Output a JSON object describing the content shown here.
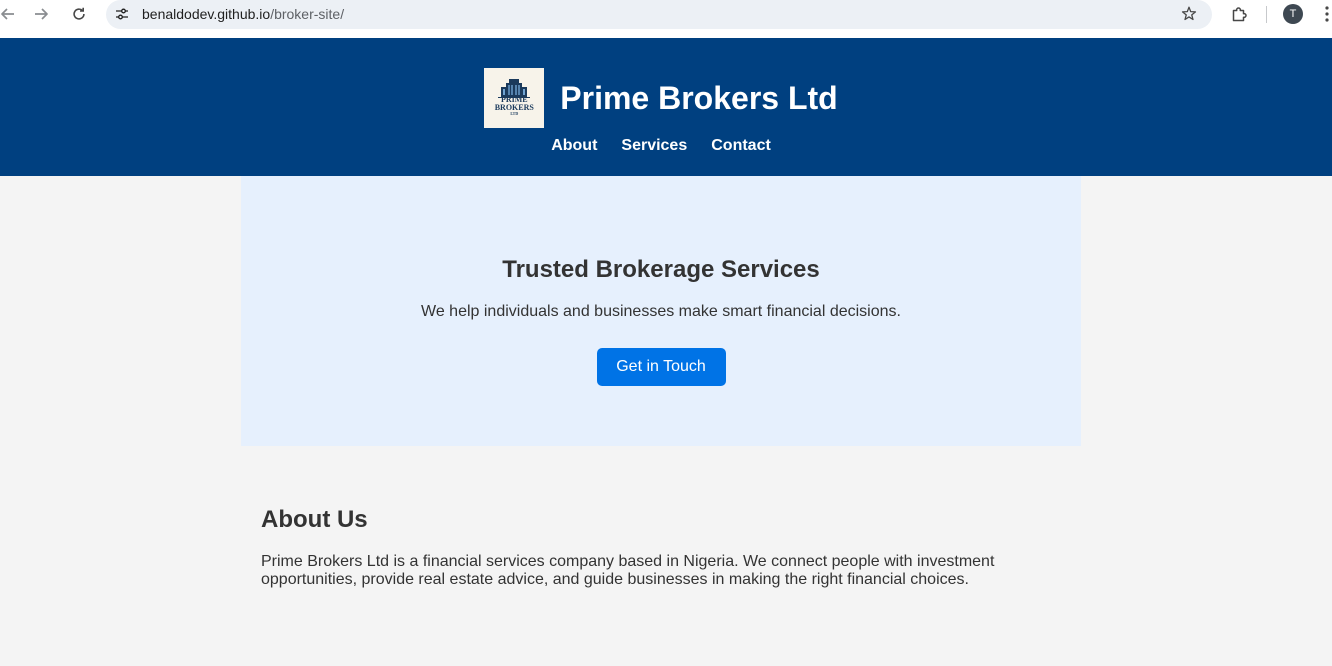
{
  "browser": {
    "url_host": "benaldodev.github.io",
    "url_path": "/broker-site/",
    "profile_initial": "T",
    "icons": {
      "back": "back-arrow-icon",
      "forward": "forward-arrow-icon",
      "reload": "reload-icon",
      "site_info": "tune-icon",
      "bookmark": "star-icon",
      "extensions": "puzzle-icon",
      "menu": "kebab-menu-icon"
    }
  },
  "header": {
    "logo_lines": [
      "PRIME",
      "BROKERS",
      "LTD"
    ],
    "title": "Prime Brokers Ltd",
    "nav": [
      {
        "label": "About"
      },
      {
        "label": "Services"
      },
      {
        "label": "Contact"
      }
    ]
  },
  "hero": {
    "heading": "Trusted Brokerage Services",
    "text": "We help individuals and businesses make smart financial decisions.",
    "cta_label": "Get in Touch"
  },
  "about": {
    "heading": "About Us",
    "text": "Prime Brokers Ltd is a financial services company based in Nigeria. We connect people with investment opportunities, provide real estate advice, and guide businesses in making the right financial choices."
  },
  "colors": {
    "header_bg": "#004080",
    "page_bg": "#f4f4f4",
    "hero_bg": "#e6f0fd",
    "button_bg": "#0073e6",
    "text": "#333333",
    "omnibox_bg": "#ecf0f5",
    "logo_bg": "#f7f3ea",
    "logo_ink": "#1b3a5c"
  }
}
